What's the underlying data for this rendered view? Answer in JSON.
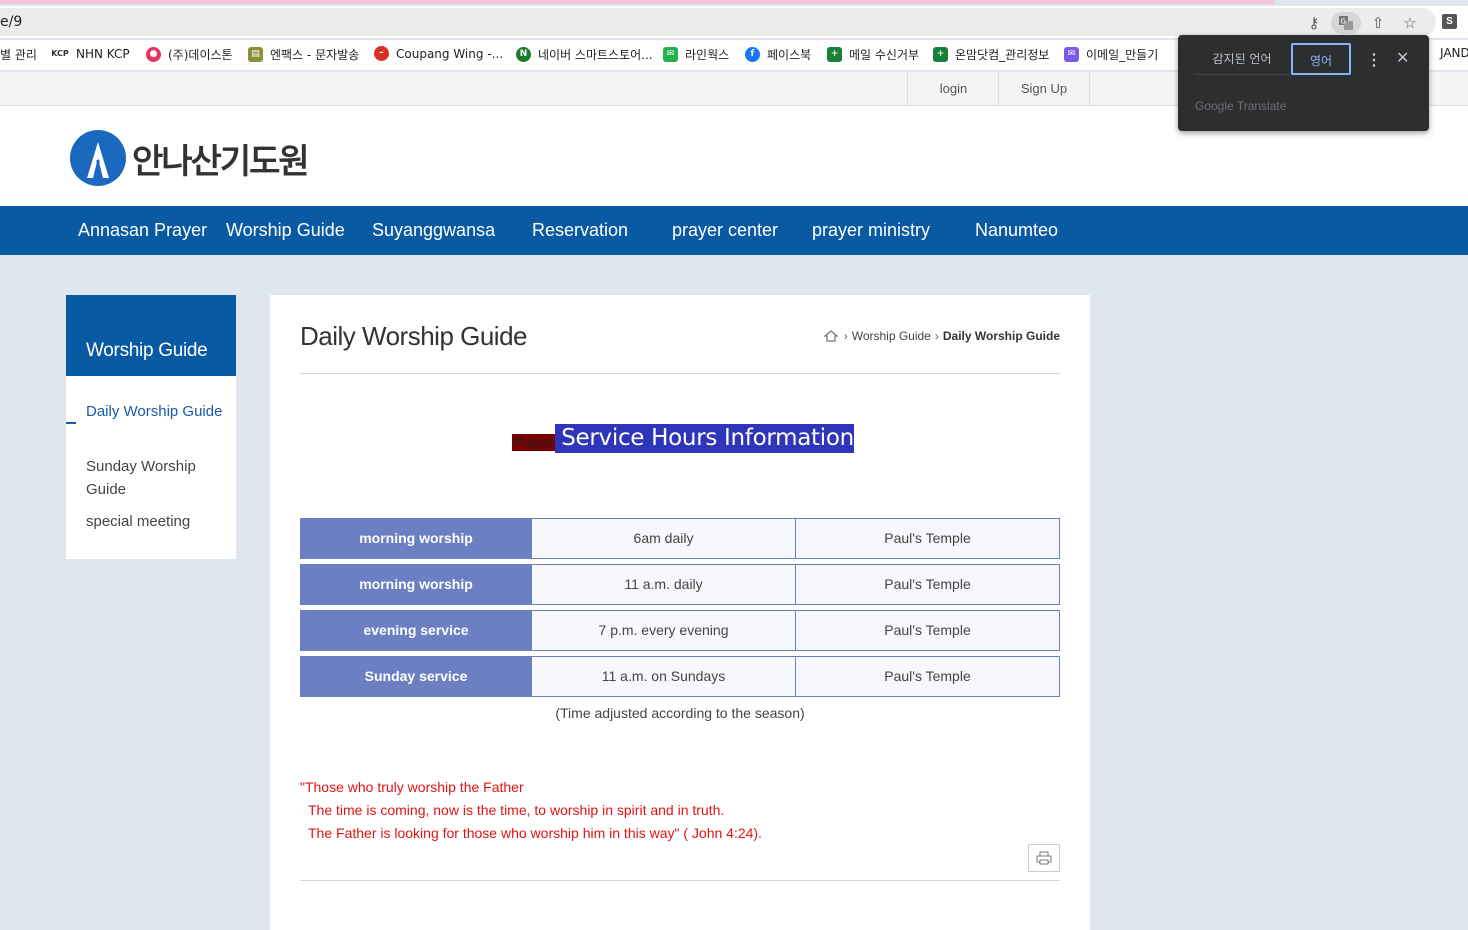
{
  "browser": {
    "url_fragment": "e/9",
    "bookmarks": [
      {
        "label": "별 관리"
      },
      {
        "label": "NHN KCP"
      },
      {
        "label": "(주)데이스톤"
      },
      {
        "label": "엔팩스 - 문자발송"
      },
      {
        "label": "Coupang Wing -..."
      },
      {
        "label": "네이버 스마트스토어..."
      },
      {
        "label": "라인웍스"
      },
      {
        "label": "페이스북"
      },
      {
        "label": "메일 수신거부"
      },
      {
        "label": "온맘닷컴_관리정보"
      },
      {
        "label": "이메일_만들기"
      },
      {
        "label": "JAND"
      }
    ],
    "profile_letter": "S"
  },
  "translate_popup": {
    "detected_label": "감지된 언어",
    "target_label": "영어",
    "brand": "Google Translate"
  },
  "site": {
    "top_links": {
      "login": "login",
      "signup": "Sign Up"
    },
    "logo_text": "안나산기도원",
    "nav": [
      "Annasan Prayer",
      "Worship Guide",
      "Suyanggwansa",
      "Reservation",
      "prayer center",
      "prayer ministry",
      "Nanumteo"
    ],
    "side": {
      "title": "Worship Guide",
      "items": [
        "Daily Worship Guide",
        "Sunday Worship Guide",
        "special meeting"
      ]
    },
    "content": {
      "title": "Daily Worship Guide",
      "breadcrumb": {
        "parent": "Worship Guide",
        "current": "Daily Worship Guide"
      },
      "headline_small": "Prayer",
      "headline_main": " Service Hours Information",
      "schedule": [
        {
          "name": "morning worship",
          "time": "6am daily",
          "place": "Paul's Temple"
        },
        {
          "name": "morning worship",
          "time": "11 a.m. daily",
          "place": "Paul's Temple"
        },
        {
          "name": "evening service",
          "time": "7 p.m. every evening",
          "place": "Paul's Temple"
        },
        {
          "name": "Sunday service",
          "time": "11 a.m. on Sundays",
          "place": "Paul's Temple"
        }
      ],
      "note": "(Time adjusted according to the season)",
      "verse": [
        "\"Those who truly worship the Father",
        "The time is coming, now is the time, to worship in spirit and in truth.",
        "The Father is looking for those who worship him in this way\" ( John 4:24)."
      ]
    }
  },
  "colors": {
    "nav_blue": "#0a5aa3",
    "table_header": "#6c7fc2",
    "verse_red": "#e01414"
  }
}
